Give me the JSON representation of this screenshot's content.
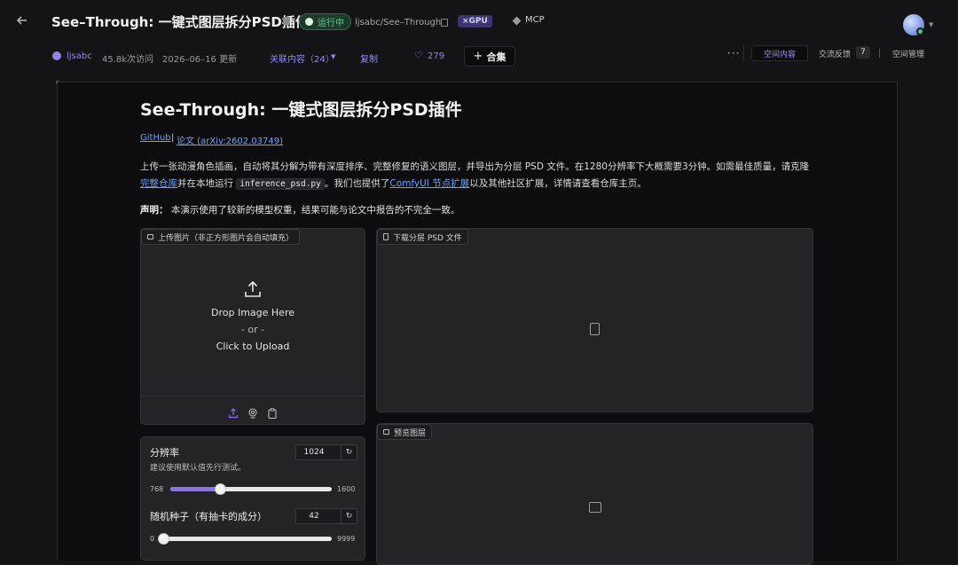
{
  "header": {
    "space_title": "See–Through: 一键式图层拆分PSD插件",
    "status": "运行中",
    "repo": "ljsabc/See–Through",
    "gpu_badge": "×GPU",
    "mcp": "MCP",
    "owner": "ljsabc",
    "visits": "45.8k次访问",
    "updated": "2026–06–16 更新",
    "related": "关联内容（24）",
    "copy": "复制",
    "likes": "279",
    "collection": "合集",
    "more": "···",
    "space_content": "空间内容",
    "feedback": "交流反馈",
    "feedback_count": "7",
    "manage": "空间管理"
  },
  "app": {
    "title": "See-Through: 一键式图层拆分PSD插件",
    "github": "GitHub",
    "sep": "|",
    "paper": "论文 (arXiv:2602.03749)",
    "desc_1": "上传一张动漫角色插画，自动将其分解为带有深度排序、完整修复的语义图层，并导出为分层 PSD 文件。在1280分辨率下大概需要3分钟。如需最佳质量，请克隆",
    "desc_link_1": "完整仓库",
    "desc_2": "并在本地运行",
    "desc_code": "inference_psd.py",
    "desc_3": "。我们也提供了",
    "desc_link_2": "ComfyUI 节点扩展",
    "desc_4": "以及其他社区扩展，详情请查看仓库主页。",
    "disclaimer_label": "声明：",
    "disclaimer_text": " 本演示使用了较新的模型权重，结果可能与论文中报告的不完全一致。",
    "upload_tab": "上传图片（非正方形图片会自动填充）",
    "drop_line1": "Drop Image Here",
    "drop_line2": "- or -",
    "drop_line3": "Click to Upload",
    "download_tab": "下载分层 PSD 文件",
    "preview_tab": "预览图层",
    "resolution_label": "分辨率",
    "resolution_hint": "建议使用默认值先行测试。",
    "resolution_value": "1024",
    "resolution_min": "768",
    "resolution_max": "1600",
    "seed_label": "随机种子（有抽卡的成分）",
    "seed_value": "42",
    "seed_min": "0",
    "seed_max": "9999",
    "reset_glyph": "↻"
  },
  "sliders": {
    "resolution_fraction": 0.31,
    "seed_fraction": 0.0042
  },
  "colors": {
    "accent": "#8f6cf0",
    "link": "#6aa3ff",
    "status_green": "#5fd38a",
    "space_content": "#9b93ff"
  }
}
